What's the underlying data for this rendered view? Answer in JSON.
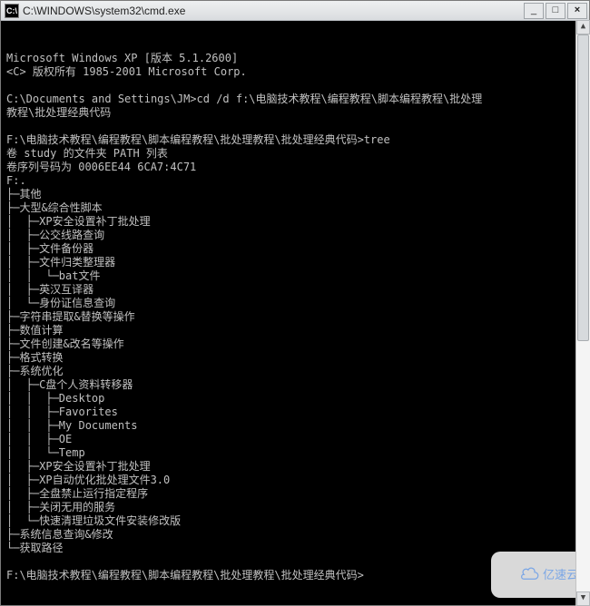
{
  "window": {
    "icon_label": "C:\\",
    "title": "C:\\WINDOWS\\system32\\cmd.exe",
    "min": "_",
    "max": "□",
    "close": "×"
  },
  "lines": [
    "Microsoft Windows XP [版本 5.1.2600]",
    "<C> 版权所有 1985-2001 Microsoft Corp.",
    "",
    "C:\\Documents and Settings\\JM>cd /d f:\\电脑技术教程\\编程教程\\脚本编程教程\\批处理",
    "教程\\批处理经典代码",
    "",
    "F:\\电脑技术教程\\编程教程\\脚本编程教程\\批处理教程\\批处理经典代码>tree",
    "卷 study 的文件夹 PATH 列表",
    "卷序列号码为 0006EE44 6CA7:4C71",
    "F:.",
    "├─其他",
    "├─大型&综合性脚本",
    "│  ├─XP安全设置补丁批处理",
    "│  ├─公交线路查询",
    "│  ├─文件备份器",
    "│  ├─文件归类整理器",
    "│  │  └─bat文件",
    "│  ├─英汉互译器",
    "│  └─身份证信息查询",
    "├─字符串提取&替换等操作",
    "├─数值计算",
    "├─文件创建&改名等操作",
    "├─格式转换",
    "├─系统优化",
    "│  ├─C盘个人资料转移器",
    "│  │  ├─Desktop",
    "│  │  ├─Favorites",
    "│  │  ├─My Documents",
    "│  │  ├─OE",
    "│  │  └─Temp",
    "│  ├─XP安全设置补丁批处理",
    "│  ├─XP自动优化批处理文件3.0",
    "│  ├─全盘禁止运行指定程序",
    "│  ├─关闭无用的服务",
    "│  └─快速清理垃圾文件安装修改版",
    "├─系统信息查询&修改",
    "└─获取路径",
    "",
    "F:\\电脑技术教程\\编程教程\\脚本编程教程\\批处理教程\\批处理经典代码>"
  ],
  "watermark": {
    "icon": "cloud-icon",
    "text": "亿速云"
  },
  "scrollbar": {
    "up": "▲",
    "down": "▼"
  }
}
